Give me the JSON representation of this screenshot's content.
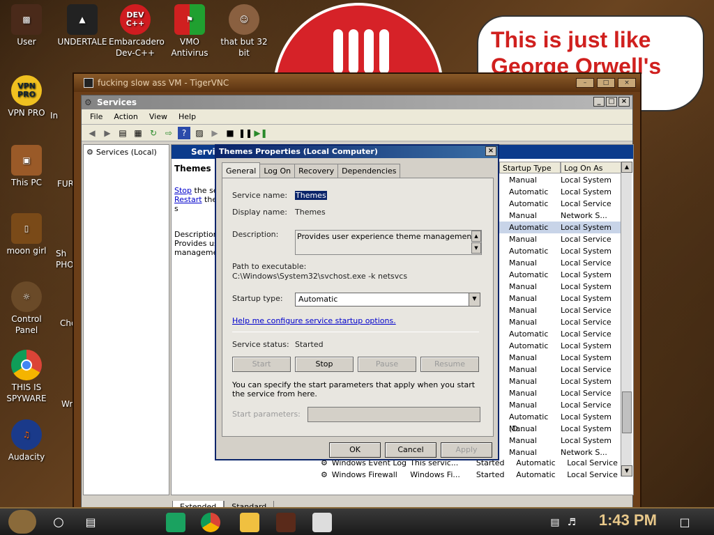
{
  "desktop": {
    "icons": [
      {
        "label": "User"
      },
      {
        "label": "UNDERTALE"
      },
      {
        "label": "Embarcadero Dev-C++"
      },
      {
        "label": "VMO Antivirus"
      },
      {
        "label": "that but 32 bit"
      },
      {
        "label": "VPN PRO"
      },
      {
        "label": "This PC"
      },
      {
        "label": "moon girl"
      },
      {
        "label": "Control Panel"
      },
      {
        "label": "THIS IS SPYWARE"
      },
      {
        "label": "Audacity"
      }
    ],
    "icon_badges": {
      "devcpp": "DEV C++",
      "vpn": "VPN PRO"
    },
    "partial_labels": [
      "In",
      "FUR",
      "Sh PHO",
      "Cho",
      "Wr"
    ],
    "speech_bubble": "This is just like George Orwell's"
  },
  "vnc": {
    "title": "fucking slow ass VM - TigerVNC"
  },
  "services": {
    "title": "Services",
    "menu": [
      "File",
      "Action",
      "View",
      "Help"
    ],
    "tree_item": "Services (Local)",
    "header": "Servi",
    "selected_name": "Themes",
    "stop_link": "Stop",
    "stop_rest": "the ser",
    "restart_link": "Restart",
    "restart_rest": "the s",
    "desc_label": "Description:",
    "desc_text1": "Provides use",
    "desc_text2": "managemen",
    "col_startup": "Startup Type",
    "col_logon": "Log On As",
    "rows": [
      {
        "startup": "Manual",
        "logon": "Local System"
      },
      {
        "startup": "Automatic",
        "logon": "Local System"
      },
      {
        "startup": "Automatic",
        "logon": "Local Service"
      },
      {
        "startup": "Manual",
        "logon": "Network S..."
      },
      {
        "startup": "Automatic",
        "logon": "Local System"
      },
      {
        "startup": "Manual",
        "logon": "Local Service"
      },
      {
        "startup": "Automatic",
        "logon": "Local System"
      },
      {
        "startup": "Manual",
        "logon": "Local Service"
      },
      {
        "startup": "Automatic",
        "logon": "Local System"
      },
      {
        "startup": "Manual",
        "logon": "Local System"
      },
      {
        "startup": "Manual",
        "logon": "Local System"
      },
      {
        "startup": "Manual",
        "logon": "Local Service"
      },
      {
        "startup": "Manual",
        "logon": "Local Service"
      },
      {
        "startup": "Automatic",
        "logon": "Local Service"
      },
      {
        "startup": "Automatic",
        "logon": "Local System"
      },
      {
        "startup": "Manual",
        "logon": "Local System"
      },
      {
        "startup": "Manual",
        "logon": "Local Service"
      },
      {
        "startup": "Manual",
        "logon": "Local System"
      },
      {
        "startup": "Manual",
        "logon": "Local Service"
      },
      {
        "startup": "Manual",
        "logon": "Local Service"
      },
      {
        "startup": "Automatic (D...",
        "logon": "Local System"
      },
      {
        "startup": "Manual",
        "logon": "Local System"
      },
      {
        "startup": "Manual",
        "logon": "Local System"
      },
      {
        "startup": "Manual",
        "logon": "Network S..."
      }
    ],
    "bottom_rows": [
      {
        "name": "Windows Event Log",
        "desc": "This servic...",
        "status": "Started",
        "startup": "Automatic",
        "logon": "Local Service"
      },
      {
        "name": "Windows Firewall",
        "desc": "Windows Fi...",
        "status": "Started",
        "startup": "Automatic",
        "logon": "Local Service"
      }
    ],
    "tabs": [
      "Extended",
      "Standard"
    ]
  },
  "dialog": {
    "title": "Themes Properties (Local Computer)",
    "tabs": [
      "General",
      "Log On",
      "Recovery",
      "Dependencies"
    ],
    "service_name_label": "Service name:",
    "service_name": "Themes",
    "display_name_label": "Display name:",
    "display_name": "Themes",
    "description_label": "Description:",
    "description": "Provides user experience theme management.",
    "path_label": "Path to executable:",
    "path": "C:\\Windows\\System32\\svchost.exe -k netsvcs",
    "startup_label": "Startup type:",
    "startup_value": "Automatic",
    "help_link": "Help me configure service startup options.",
    "status_label": "Service status:",
    "status_value": "Started",
    "btn_start": "Start",
    "btn_stop": "Stop",
    "btn_pause": "Pause",
    "btn_resume": "Resume",
    "param_text": "You can specify the start parameters that apply when you start the service from here.",
    "param_label": "Start parameters:",
    "ok": "OK",
    "cancel": "Cancel",
    "apply": "Apply"
  },
  "taskbar": {
    "clock": "1:43 PM"
  },
  "colors": {
    "title_blue": "#0a246a",
    "header_blue": "#0b3b8c",
    "link": "#0000cc",
    "clock": "#e8c88a",
    "stop_red": "#d62228"
  }
}
